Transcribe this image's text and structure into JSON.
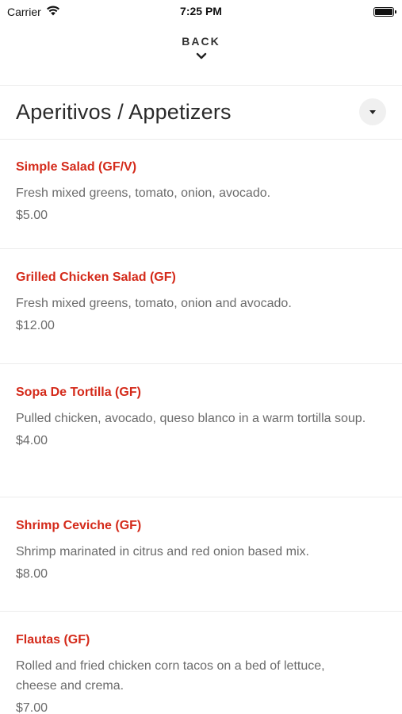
{
  "status_bar": {
    "carrier": "Carrier",
    "time": "7:25 PM"
  },
  "header": {
    "back_label": "BACK"
  },
  "category": {
    "title": "Aperitivos / Appetizers"
  },
  "colors": {
    "item_name": "#d42a1a",
    "text_muted": "#6b6b6b",
    "divider": "#ececec"
  },
  "menu_items": [
    {
      "name": "Simple Salad (GF/V)",
      "description": "Fresh mixed greens, tomato, onion, avocado.",
      "price": "$5.00"
    },
    {
      "name": "Grilled Chicken Salad (GF)",
      "description": "Fresh mixed greens, tomato, onion and avocado.",
      "price": "$12.00"
    },
    {
      "name": "Sopa De Tortilla (GF)",
      "description": "Pulled chicken, avocado, queso blanco in a warm tortilla soup.",
      "price": "$4.00"
    },
    {
      "name": "Shrimp Ceviche (GF)",
      "description": "Shrimp marinated in citrus and red onion based mix.",
      "price": "$8.00"
    },
    {
      "name": "Flautas (GF)",
      "description": "Rolled and fried chicken corn tacos on a bed of lettuce, cheese and crema.",
      "price": "$7.00"
    }
  ]
}
